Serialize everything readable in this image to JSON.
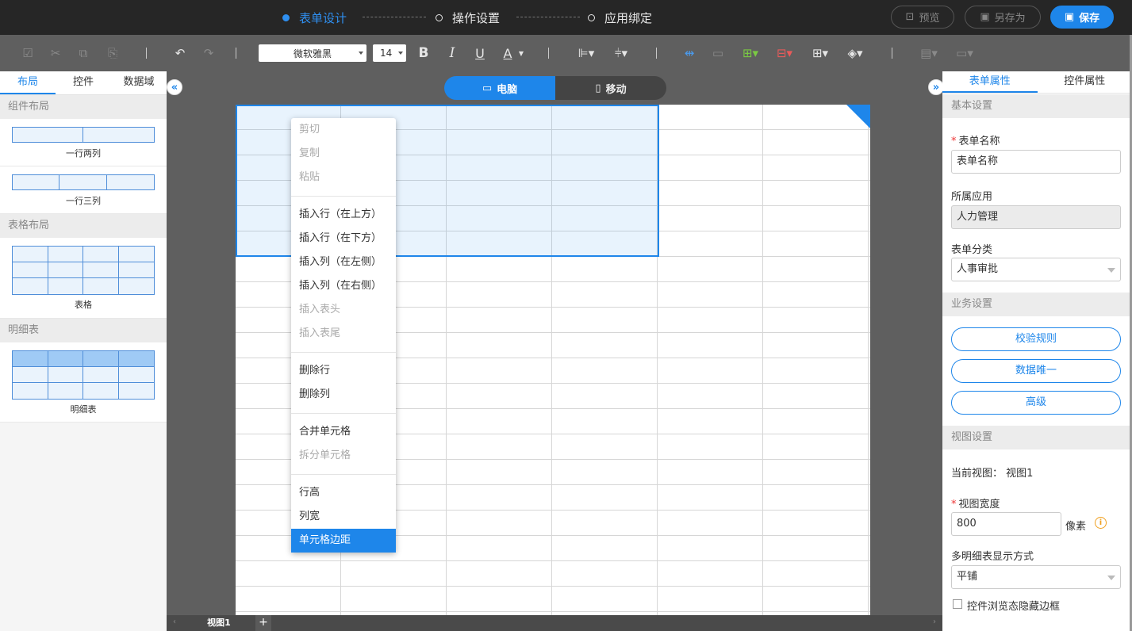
{
  "steps": [
    "表单设计",
    "操作设置",
    "应用绑定"
  ],
  "top_buttons": {
    "preview": "预览",
    "save_as": "另存为",
    "save": "保存"
  },
  "toolbar": {
    "font": "微软雅黑",
    "size": "14",
    "bold": "B",
    "italic": "I",
    "underline": "U",
    "font_color": "A"
  },
  "left": {
    "tabs": [
      "布局",
      "控件",
      "数据域"
    ],
    "sections": [
      "组件布局",
      "表格布局",
      "明细表"
    ],
    "items": [
      "一行两列",
      "一行三列",
      "表格",
      "明细表"
    ]
  },
  "device": {
    "pc": "电脑",
    "mobile": "移动"
  },
  "context_menu": [
    "剪切",
    "复制",
    "粘贴",
    "插入行（在上方）",
    "插入行（在下方）",
    "插入列（在左侧）",
    "插入列（在右侧）",
    "插入表头",
    "插入表尾",
    "删除行",
    "删除列",
    "合并单元格",
    "拆分单元格",
    "行高",
    "列宽",
    "单元格边距"
  ],
  "view_tab": "视图1",
  "right": {
    "tabs": [
      "表单属性",
      "控件属性"
    ],
    "basic": "基本设置",
    "form_name_label": "表单名称",
    "form_name_value": "表单名称",
    "app_label": "所属应用",
    "app_value": "人力管理",
    "category_label": "表单分类",
    "category_value": "人事审批",
    "business": "业务设置",
    "btn_rules": "校验规则",
    "btn_unique": "数据唯一",
    "btn_advanced": "高级",
    "view": "视图设置",
    "current_view": "当前视图： 视图1",
    "width_label": "视图宽度",
    "width_value": "800",
    "unit": "像素",
    "multi_label": "多明细表显示方式",
    "multi_value": "平铺",
    "hide_border": "控件浏览态隐藏边框"
  }
}
